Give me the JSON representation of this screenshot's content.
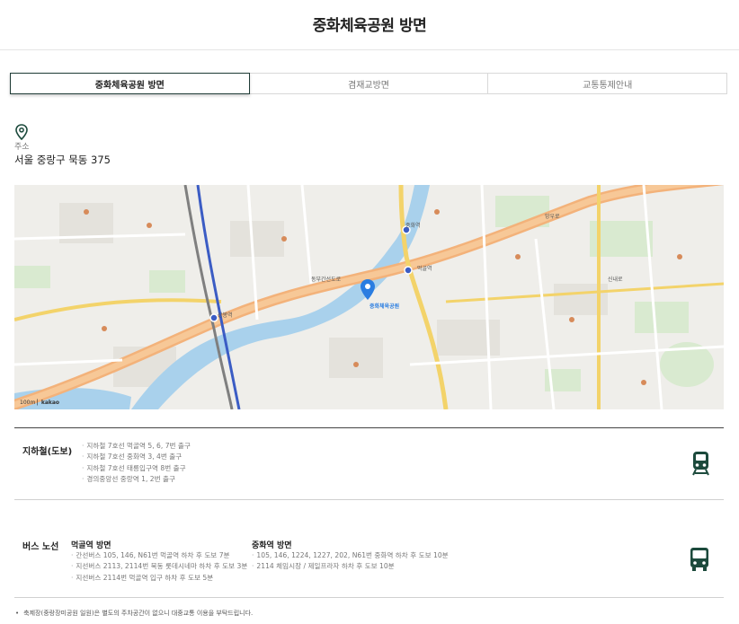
{
  "header": {
    "title": "중화체육공원 방면"
  },
  "tabs": [
    {
      "label": "중화체육공원 방면",
      "active": true
    },
    {
      "label": "겸재교방면",
      "active": false
    },
    {
      "label": "교통통제안내",
      "active": false
    }
  ],
  "address": {
    "label": "주소",
    "value": "서울 중랑구 묵동 375"
  },
  "map": {
    "labels": {
      "dongbu": "동부간선도로",
      "sinnae": "신내로",
      "mangwu": "망우로",
      "junghwa": "중화역",
      "meokgol": "먹골역",
      "sangbong": "상봉역",
      "park": "중화체육공원"
    },
    "scale": "100m",
    "logo": "kakao"
  },
  "subway": {
    "title": "지하철(도보)",
    "items": [
      "지하철 7호선 먹골역 5, 6, 7번 출구",
      "지하철 7호선 중화역 3, 4번 출구",
      "지하철 7호선 태릉입구역 8번 출구",
      "경의중앙선 중랑역 1, 2번 출구"
    ]
  },
  "bus": {
    "title": "버스 노선",
    "meokgol": {
      "title": "먹골역 방면",
      "items": [
        "간선버스 105, 146, N61번 먹골역 하차 후 도보 7분",
        "지선버스 2113, 2114번 묵동 롯데시네마 하차 후 도보 3분",
        "지선버스 2114번 먹골역 입구 하차 후 도보 5분"
      ]
    },
    "junghwa": {
      "title": "중화역 방면",
      "items": [
        "105, 146, 1224, 1227, 202, N61번 중화역 하차 후 도보 10분",
        "2114 체임시장 / 제일프라자 하차 후 도보 10분"
      ]
    }
  },
  "note": "축제장(중랑장미공원 일원)은 별도의 주차공간이 없으니 대중교통 이용을 부탁드립니다.",
  "colors": {
    "accent": "#1f3b36",
    "icon": "#1c4a3c",
    "pin": "#2a7de1"
  },
  "icons": {
    "address": "map-pin-icon",
    "subway": "train-icon",
    "bus": "bus-icon"
  }
}
